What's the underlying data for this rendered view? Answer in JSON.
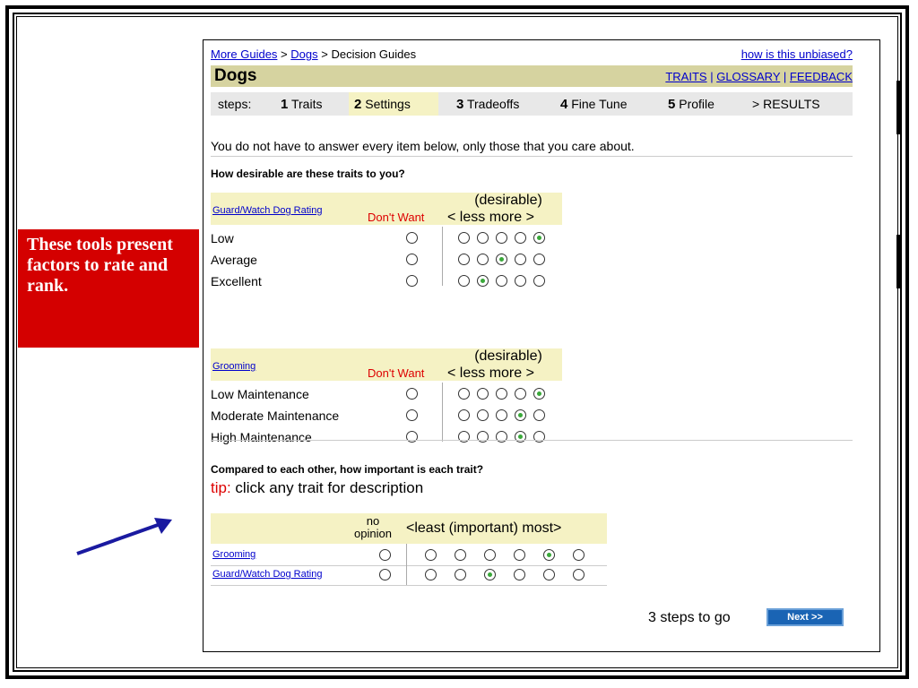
{
  "breadcrumb": {
    "more_guides": "More Guides",
    "sep1": ">",
    "dogs": "Dogs",
    "sep2": ">",
    "current": "Decision Guides"
  },
  "header": {
    "unbiased_link": "how is this unbiased?",
    "title": "Dogs",
    "traits": "TRAITS",
    "glossary": "GLOSSARY",
    "feedback": "FEEDBACK",
    "pipe": "|"
  },
  "steps": {
    "label": "steps:",
    "items": [
      {
        "num": "1",
        "label": "Traits"
      },
      {
        "num": "2",
        "label": "Settings"
      },
      {
        "num": "3",
        "label": "Tradeoffs"
      },
      {
        "num": "4",
        "label": "Fine Tune"
      },
      {
        "num": "5",
        "label": "Profile"
      },
      {
        "num": ">",
        "label": "RESULTS"
      }
    ]
  },
  "intro": "You do not have to answer every item below, only those that you care about.",
  "question1": "How desirable are these traits to you?",
  "trait_table_headers": {
    "dont_want": "Don't Want",
    "desirable": "(desirable)",
    "less_more": "< less  more >"
  },
  "traits": [
    {
      "name": "Guard/Watch Dog Rating",
      "rows": [
        {
          "label": "Low",
          "selected": 4
        },
        {
          "label": "Average",
          "selected": 2
        },
        {
          "label": "Excellent",
          "selected": 1
        }
      ]
    },
    {
      "name": "Grooming",
      "rows": [
        {
          "label": "Low Maintenance",
          "selected": 4
        },
        {
          "label": "Moderate Maintenance",
          "selected": 3
        },
        {
          "label": "High Maintenance",
          "selected": 3
        }
      ]
    }
  ],
  "question2": "Compared to each other, how important is each trait?",
  "tip": {
    "prefix": "tip:",
    "text": " click any trait for description"
  },
  "importance_headers": {
    "no_opinion_1": "no",
    "no_opinion_2": "opinion",
    "scale": "<least (important) most>"
  },
  "importance": [
    {
      "name": "Grooming",
      "selected": 5
    },
    {
      "name": "Guard/Watch Dog Rating",
      "selected": 3
    }
  ],
  "footer": {
    "steps_to_go": "3 steps to go",
    "next_label": "Next >>"
  },
  "callout": {
    "text": "These tools present factors to rate and rank.",
    "color": "#d40000"
  },
  "colors": {
    "title_bar": "#d6d3a0",
    "header_bg": "#f5f2c4",
    "link": "#0000cc",
    "next_btn": "#1a64b4"
  }
}
